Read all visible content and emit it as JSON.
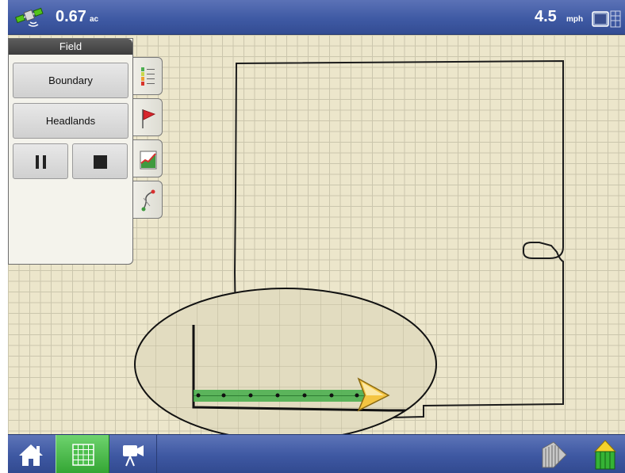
{
  "status_bar": {
    "gps_icon": "gps-satellite-icon",
    "area_value": "0.67",
    "area_unit": "ac",
    "speed_value": "4.5",
    "speed_unit": "mph",
    "display_icon": "display-layout-icon"
  },
  "field_panel": {
    "title": "Field",
    "boundary_label": "Boundary",
    "headlands_label": "Headlands",
    "pause_icon": "pause-icon",
    "stop_icon": "stop-icon"
  },
  "side_tabs": [
    {
      "icon": "legend-list-icon"
    },
    {
      "icon": "flag-icon"
    },
    {
      "icon": "coverage-chart-icon"
    },
    {
      "icon": "guidance-line-icon"
    }
  ],
  "bottom_nav": [
    {
      "icon": "home-icon"
    },
    {
      "icon": "map-grid-icon",
      "active": true
    },
    {
      "icon": "video-camera-icon"
    },
    {
      "icon": "implement-icon"
    },
    {
      "icon": "vehicle-icon"
    }
  ],
  "colors": {
    "bar_blue": "#3f5aa4",
    "map_background": "#ece6cb",
    "grid_line": "#cbc6ad",
    "coverage_green": "#4caf50",
    "active_tab_green": "#33a533",
    "vehicle_arrow": "#f4c542"
  }
}
